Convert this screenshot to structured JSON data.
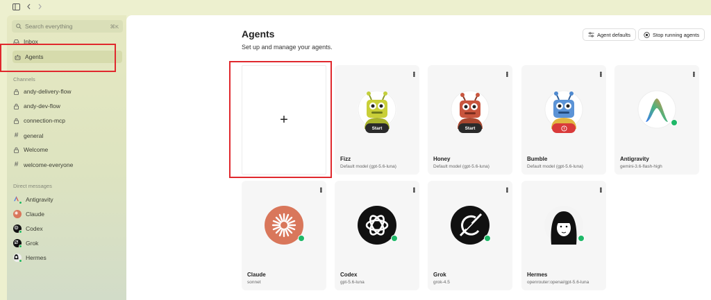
{
  "sidebar": {
    "search_placeholder": "Search everything",
    "search_shortcut": "⌘K",
    "inbox": "Inbox",
    "agents": "Agents",
    "channels_heading": "Channels",
    "channels": [
      "andy-delivery-flow",
      "andy-dev-flow",
      "connection-mcp",
      "general",
      "Welcome",
      "welcome-everyone"
    ],
    "dm_heading": "Direct messages",
    "dms": [
      "Antigravity",
      "Claude",
      "Codex",
      "Grok",
      "Hermes"
    ]
  },
  "main": {
    "title": "Agents",
    "subtitle": "Set up and manage your agents.",
    "agent_defaults": "Agent defaults",
    "stop_running": "Stop running agents",
    "new_agent_glyph": "+",
    "start_label": "Start",
    "agents": [
      {
        "name": "Fizz",
        "model": "Default model (gpt-5.6-luna)"
      },
      {
        "name": "Honey",
        "model": "Default model (gpt-5.6-luna)"
      },
      {
        "name": "Bumble",
        "model": "Default model (gpt-5.6-luna)"
      },
      {
        "name": "Antigravity",
        "model": "gemini-3.6-flash-high"
      },
      {
        "name": "Claude",
        "model": "sonnet"
      },
      {
        "name": "Codex",
        "model": "gpt-5.6-luna"
      },
      {
        "name": "Grok",
        "model": "grok-4.5"
      },
      {
        "name": "Hermes",
        "model": "openrouter:openai/gpt-5.6-luna"
      }
    ]
  },
  "colors": {
    "highlight": "#e0282d",
    "online": "#1fb868",
    "claude": "#d9775b"
  }
}
